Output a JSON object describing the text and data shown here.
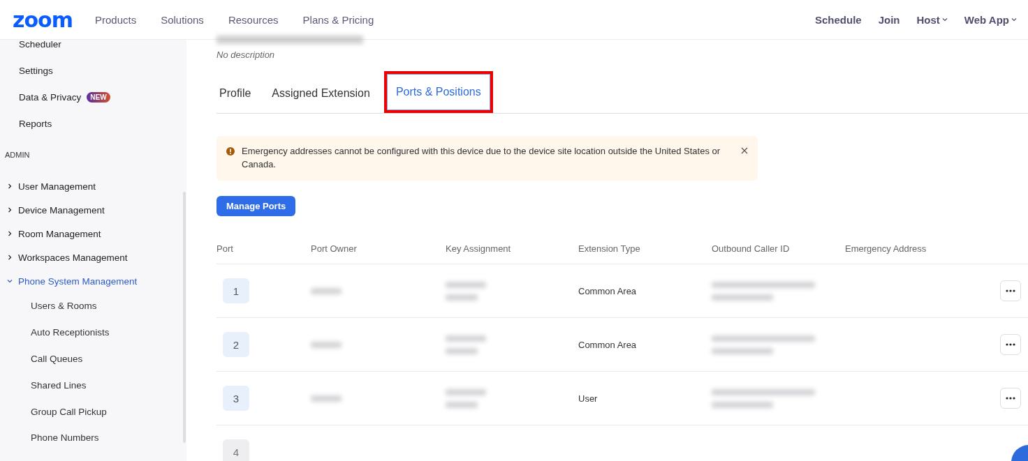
{
  "header": {
    "logo": "zoom",
    "nav": [
      {
        "label": "Products"
      },
      {
        "label": "Solutions"
      },
      {
        "label": "Resources"
      },
      {
        "label": "Plans & Pricing"
      }
    ],
    "actions": [
      {
        "label": "Schedule",
        "dropdown": false
      },
      {
        "label": "Join",
        "dropdown": false
      },
      {
        "label": "Host",
        "dropdown": true
      },
      {
        "label": "Web App",
        "dropdown": true
      }
    ]
  },
  "sidebar": {
    "items": [
      {
        "label": "Scheduler"
      },
      {
        "label": "Settings"
      },
      {
        "label": "Data & Privacy",
        "badge": "NEW"
      },
      {
        "label": "Reports"
      }
    ],
    "section": "ADMIN",
    "groups": [
      {
        "label": "User Management",
        "expanded": false
      },
      {
        "label": "Device Management",
        "expanded": false
      },
      {
        "label": "Room Management",
        "expanded": false
      },
      {
        "label": "Workspaces Management",
        "expanded": false
      },
      {
        "label": "Phone System Management",
        "expanded": true,
        "children": [
          {
            "label": "Users & Rooms"
          },
          {
            "label": "Auto Receptionists"
          },
          {
            "label": "Call Queues"
          },
          {
            "label": "Shared Lines"
          },
          {
            "label": "Group Call Pickup"
          },
          {
            "label": "Phone Numbers"
          }
        ]
      }
    ]
  },
  "description": "No description",
  "tabs": [
    {
      "label": "Profile",
      "selected": false,
      "highlighted": false
    },
    {
      "label": "Assigned Extension",
      "selected": false,
      "highlighted": false
    },
    {
      "label": "Ports & Positions",
      "selected": true,
      "highlighted": true
    }
  ],
  "alert": {
    "text": "Emergency addresses cannot be configured with this device due to the device site location outside the United States or Canada."
  },
  "manage_button": "Manage Ports",
  "table": {
    "columns": [
      "Port",
      "Port Owner",
      "Key Assignment",
      "Extension Type",
      "Outbound Caller ID",
      "Emergency Address"
    ],
    "rows": [
      {
        "port": "1",
        "disabled": false,
        "extension_type": "Common Area"
      },
      {
        "port": "2",
        "disabled": false,
        "extension_type": "Common Area"
      },
      {
        "port": "3",
        "disabled": false,
        "extension_type": "User"
      },
      {
        "port": "4",
        "disabled": true
      }
    ]
  }
}
